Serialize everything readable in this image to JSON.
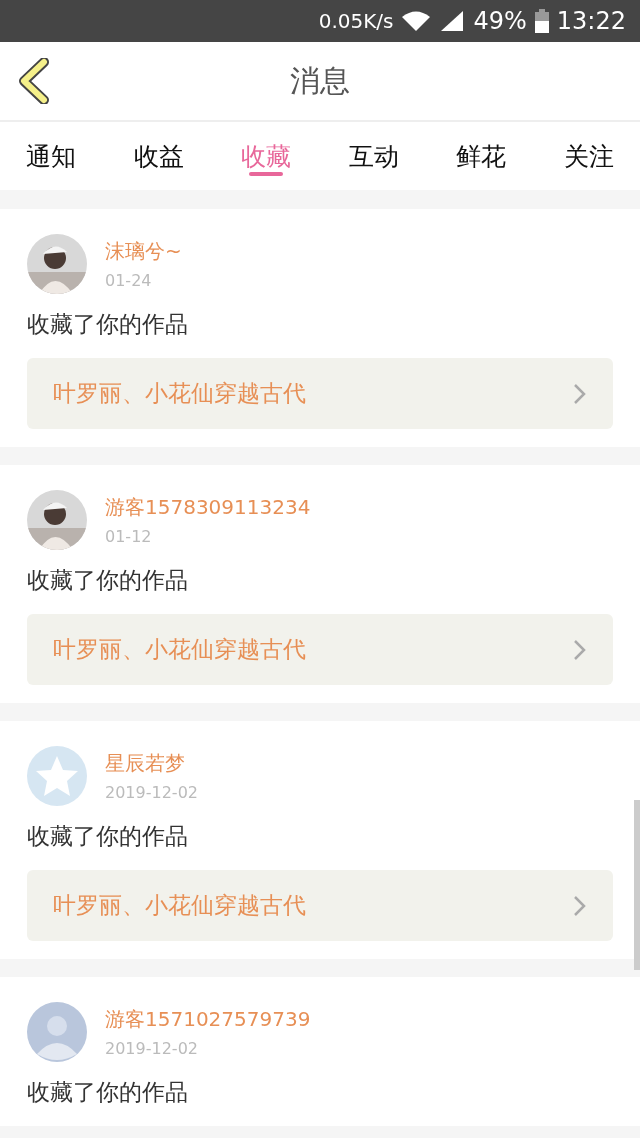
{
  "status_bar": {
    "speed": "0.05K/s",
    "battery": "49%",
    "time": "13:22"
  },
  "header": {
    "title": "消息"
  },
  "tabs": [
    {
      "label": "通知",
      "selected": false
    },
    {
      "label": "收益",
      "selected": false
    },
    {
      "label": "收藏",
      "selected": true
    },
    {
      "label": "互动",
      "selected": false
    },
    {
      "label": "鲜花",
      "selected": false
    },
    {
      "label": "关注",
      "selected": false
    }
  ],
  "messages": [
    {
      "user": "沫璃兮~",
      "date": "01-24",
      "text": "收藏了你的作品",
      "work": "叶罗丽、小花仙穿越古代"
    },
    {
      "user": "游客1578309113234",
      "date": "01-12",
      "text": "收藏了你的作品",
      "work": "叶罗丽、小花仙穿越古代"
    },
    {
      "user": "星辰若梦",
      "date": "2019-12-02",
      "avatar": {
        "kind": "star"
      },
      "text": "收藏了你的作品",
      "work": "叶罗丽、小花仙穿越古代"
    },
    {
      "user": "游客1571027579739",
      "date": "2019-12-02",
      "avatar": {
        "kind": "person"
      },
      "text": "收藏了你的作品"
    }
  ]
}
